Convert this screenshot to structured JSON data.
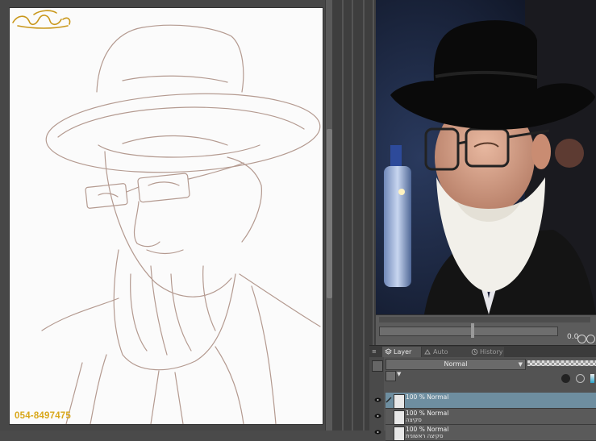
{
  "canvas": {
    "watermark_phone": "054-8497475",
    "watermark_logo_text": "ציורים"
  },
  "navigator": {
    "readout": "0.0"
  },
  "layer_palette": {
    "tabs": [
      {
        "label": "Layer",
        "active": true,
        "icon": "layers-icon"
      },
      {
        "label": "Auto Action",
        "active": false,
        "icon": "auto-action-icon"
      },
      {
        "label": "History",
        "active": false,
        "icon": "history-icon"
      }
    ],
    "blend_mode": "Normal",
    "layers": [
      {
        "mode": "100 % Normal",
        "name": "",
        "selected": true,
        "visible": true,
        "editing": true
      },
      {
        "mode": "100 % Normal",
        "name": "סקיצה",
        "selected": false,
        "visible": true,
        "editing": false
      },
      {
        "mode": "100 % Normal",
        "name": "סקיצה ראשונית",
        "selected": false,
        "visible": true,
        "editing": false
      }
    ]
  },
  "colors": {
    "accent_selected_row": "#6e8ea0",
    "sketch_line": "#b49a90",
    "watermark_gold": "#d9a81c"
  }
}
